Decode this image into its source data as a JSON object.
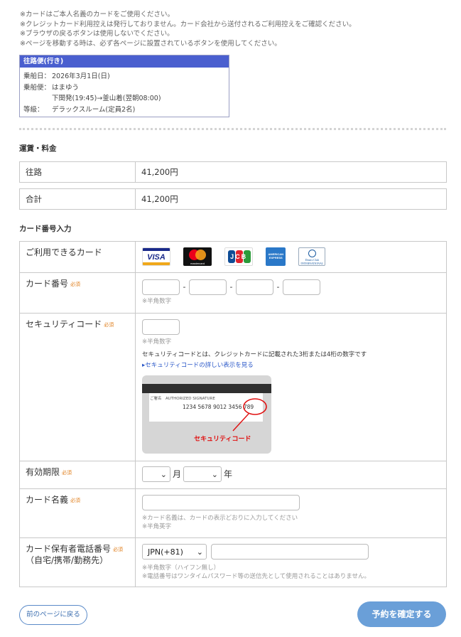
{
  "notes": [
    "※カードはご本人名義のカードをご使用ください。",
    "※クレジットカード利用控えは発行しておりません。カード会社から送付されるご利用控えをご確認ください。",
    "※ブラウザの戻るボタンは使用しないでください。",
    "※ページを移動する時は、必ず各ページに設置されているボタンを使用してください。"
  ],
  "voyage": {
    "title": "往路便(行き)",
    "date_label": "乗船日：",
    "date": "2026年3月1日(日)",
    "ship_label": "乗船便：",
    "ship": "はまゆう",
    "route": "下関発(19:45)→釜山着(翌朝08:00)",
    "class_label": "等級：",
    "class": "デラックスルーム(定員2名)"
  },
  "fare": {
    "section_title": "運賃・料金",
    "outbound_label": "往路",
    "outbound_value": "41,200円",
    "total_label": "合計",
    "total_value": "41,200円"
  },
  "card": {
    "section_title": "カード番号入力",
    "required": "必須",
    "available_label": "ご利用できるカード",
    "brands": [
      "VISA",
      "mastercard",
      "JCB",
      "AMERICAN EXPRESS",
      "Diners Club INTERNATIONAL"
    ],
    "number_label": "カード番号",
    "separator": "-",
    "number_note": "※半角数字",
    "security_label": "セキュリティコード",
    "security_note": "※半角数字",
    "security_desc": "セキュリティコードとは、クレジットカードに記載された3桁または4桁の数字です",
    "security_link": "▸セキュリティコードの詳しい表示を見る",
    "card_image": {
      "sign_label": "ご署名　AUTHORIZED SIGNATURE",
      "number": "1234 5678 9012 3456 789",
      "caption": "セキュリティコード"
    },
    "expiry_label": "有効期限",
    "month_unit": "月",
    "year_unit": "年",
    "name_label": "カード名義",
    "name_note1": "※カード名義は、カードの表示どおりに入力してください",
    "name_note2": "※半角英字",
    "phone_label": "カード保有者電話番号",
    "phone_sub": "（自宅/携帯/勤務先）",
    "phone_country": "JPN(+81)",
    "phone_note1": "※半角数字（ハイフン無し）",
    "phone_note2": "※電話番号はワンタイムパスワード等の送信先として使用されることはありません。"
  },
  "buttons": {
    "back": "前のページに戻る",
    "confirm": "予約を確定する"
  },
  "colors": {
    "voyage_header": "#4a5fcf",
    "required": "#e08020",
    "confirm_button": "#6a9fd8",
    "link": "#2a57c8",
    "cvv_highlight": "#e01010"
  }
}
